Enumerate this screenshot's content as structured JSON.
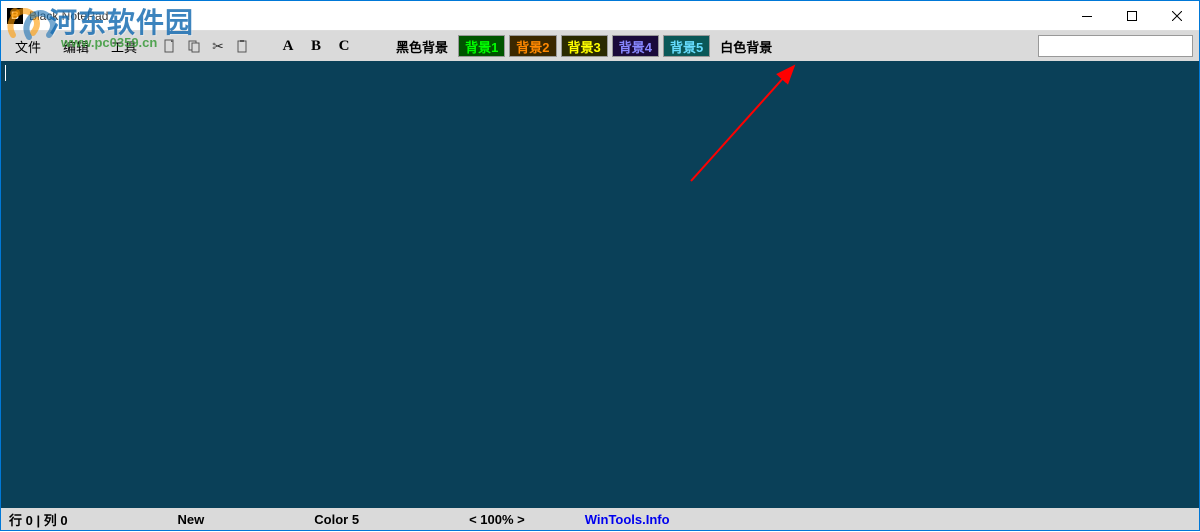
{
  "titlebar": {
    "icon_letter": "B",
    "title": "Black NotePad"
  },
  "menu": {
    "file": "文件",
    "edit": "编辑",
    "tools": "工具"
  },
  "toolbar": {
    "font_a": "A",
    "font_b": "B",
    "font_c": "C",
    "bg_black": "黑色背景",
    "bg1": "背景1",
    "bg2": "背景2",
    "bg3": "背景3",
    "bg4": "背景4",
    "bg5": "背景5",
    "bg_white": "白色背景",
    "search_value": ""
  },
  "statusbar": {
    "position": "行 0 | 列 0",
    "filestate": "New",
    "color": "Color 5",
    "zoom": "< 100% >",
    "link": "WinTools.Info"
  },
  "watermark": {
    "text": "河东软件园",
    "url": "www.pc0359.cn"
  },
  "chart_data": null
}
